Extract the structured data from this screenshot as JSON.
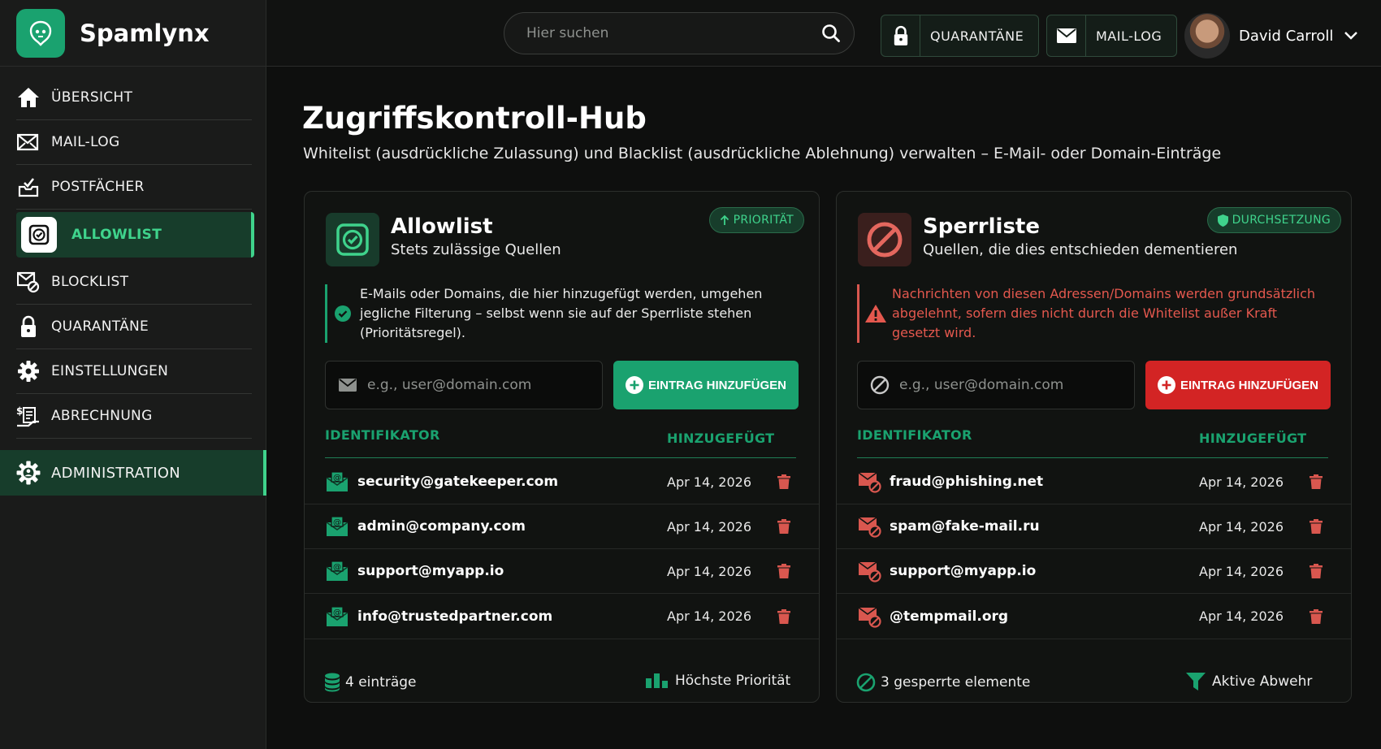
{
  "brand": {
    "name": "Spamlynx"
  },
  "sidebar": {
    "items": [
      {
        "label": "ÜBERSICHT",
        "icon": "home-icon"
      },
      {
        "label": "MAIL-LOG",
        "icon": "mail-log-icon"
      },
      {
        "label": "POSTFÄCHER",
        "icon": "inbox-icon"
      },
      {
        "label": "ALLOWLIST",
        "icon": "check-square-icon"
      },
      {
        "label": "BLOCKLIST",
        "icon": "mail-block-icon"
      },
      {
        "label": "QUARANTÄNE",
        "icon": "lock-icon"
      },
      {
        "label": "EINSTELLUNGEN",
        "icon": "gear-icon"
      },
      {
        "label": "ABRECHNUNG",
        "icon": "billing-icon"
      },
      {
        "label": "ADMINISTRATION",
        "icon": "admin-gear-icon"
      }
    ]
  },
  "topbar": {
    "search_placeholder": "Hier suchen",
    "quarantine_label": "QUARANTÄNE",
    "maillog_label": "MAIL-LOG",
    "user_name": "David Carroll"
  },
  "page": {
    "title": "Zugriffskontroll-Hub",
    "subtitle": "Whitelist (ausdrückliche Zulassung) und Blacklist (ausdrückliche Ablehnung) verwalten – E-Mail- oder Domain-Einträge"
  },
  "allowlist": {
    "title": "Allowlist",
    "subtitle": "Stets zulässige Quellen",
    "badge": "PRIORITÄT",
    "notice": "E-Mails oder Domains, die hier hinzugefügt werden, umgehen jegliche Filterung – selbst wenn sie auf der Sperrliste stehen (Prioritätsregel).",
    "input_placeholder": "e.g., user@domain.com",
    "add_label": "EINTRAG HINZUFÜGEN",
    "col_id": "IDENTIFIKATOR",
    "col_date": "HINZUGEFÜGT",
    "rows": [
      {
        "email": "security@gatekeeper.com",
        "date": "Apr 14, 2026"
      },
      {
        "email": "admin@company.com",
        "date": "Apr 14, 2026"
      },
      {
        "email": "support@myapp.io",
        "date": "Apr 14, 2026"
      },
      {
        "email": "info@trustedpartner.com",
        "date": "Apr 14, 2026"
      }
    ],
    "footer_count": "4 einträge",
    "footer_status": "Höchste Priorität"
  },
  "blocklist": {
    "title": "Sperrliste",
    "subtitle": "Quellen, die dies entschieden dementieren",
    "badge": "DURCHSETZUNG",
    "notice": "Nachrichten von diesen Adressen/Domains werden grundsätzlich abgelehnt, sofern dies nicht durch die Whitelist außer Kraft gesetzt wird.",
    "input_placeholder": "e.g., user@domain.com",
    "add_label": "EINTRAG HINZUFÜGEN",
    "col_id": "IDENTIFIKATOR",
    "col_date": "HINZUGEFÜGT",
    "rows": [
      {
        "email": "fraud@phishing.net",
        "date": "Apr 14, 2026"
      },
      {
        "email": "spam@fake-mail.ru",
        "date": "Apr 14, 2026"
      },
      {
        "email": "support@myapp.io",
        "date": "Apr 14, 2026"
      },
      {
        "email": "@tempmail.org",
        "date": "Apr 14, 2026"
      }
    ],
    "footer_count": "3 gesperrte elemente",
    "footer_status": "Aktive Abwehr"
  },
  "colors": {
    "accent": "#1aa26f",
    "accent_light": "#3fd38c",
    "danger": "#d32424",
    "danger_text": "#e4584e"
  }
}
